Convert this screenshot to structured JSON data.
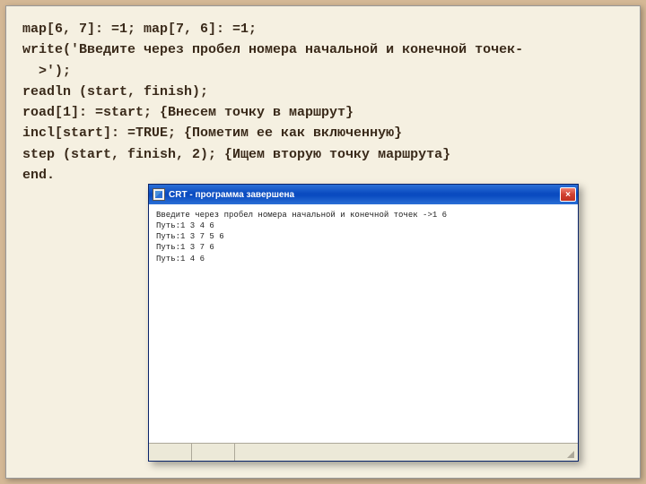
{
  "code": {
    "line1": "map[6, 7]: =1; map[7, 6]: =1;",
    "line2": "write('Введите через пробел номера начальной и конечной точек-",
    "line3": "  >');",
    "line4": "readln (start, finish);",
    "line5": "road[1]: =start; {Внесем точку в маршрут}",
    "line6": "incl[start]: =TRUE; {Пометим ее как включенную}",
    "line7": "step (start, finish, 2); {Ищем вторую точку маршрута}",
    "line8": "end."
  },
  "window": {
    "title": "CRT - программа завершена",
    "close_label": "×",
    "output_line1": "Введите через пробел номера начальной и конечной точек ->1 6",
    "output_line2": "Путь:1 3 4 6",
    "output_line3": "Путь:1 3 7 5 6",
    "output_line4": "Путь:1 3 7 6",
    "output_line5": "Путь:1 4 6"
  }
}
